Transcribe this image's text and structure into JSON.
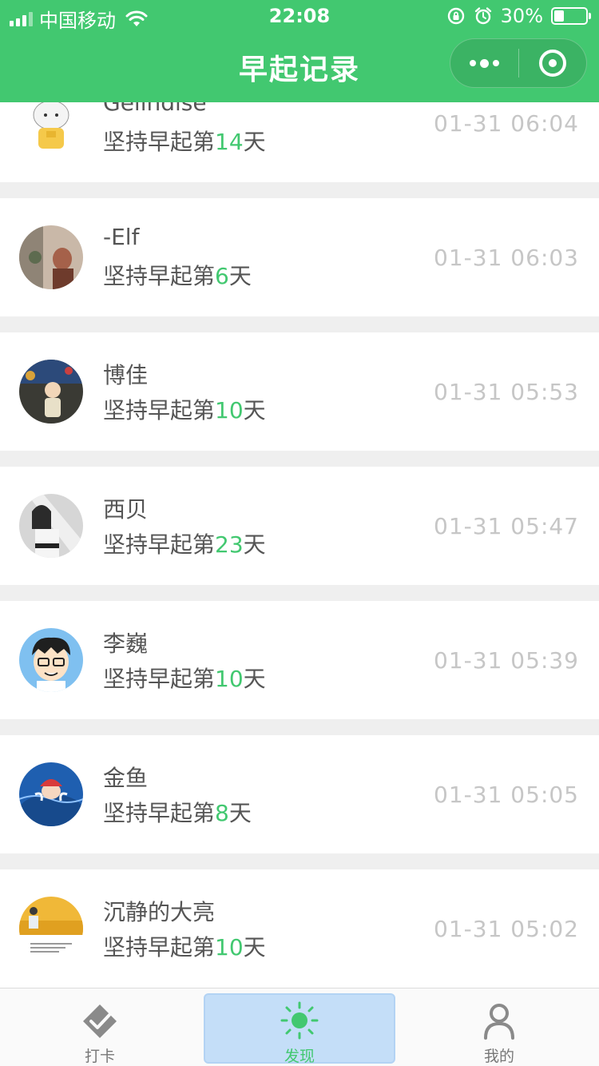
{
  "statusbar": {
    "carrier": "中国移动",
    "time": "22:08",
    "battery": "30%",
    "icons": [
      "signal-icon",
      "wifi-icon",
      "rotation-lock-icon",
      "alarm-icon",
      "battery-icon"
    ]
  },
  "navbar": {
    "title": "早起记录",
    "capsule_icons": [
      "more-icon",
      "close-miniprogram-icon"
    ]
  },
  "streak_text": {
    "prefix": "坚持早起第",
    "suffix": "天"
  },
  "records": [
    {
      "name": "Gelindise",
      "days": "14",
      "time": "01-31 06:04"
    },
    {
      "name": "-Elf",
      "days": "6",
      "time": "01-31 06:03"
    },
    {
      "name": "博佳",
      "days": "10",
      "time": "01-31 05:53"
    },
    {
      "name": "西贝",
      "days": "23",
      "time": "01-31 05:47"
    },
    {
      "name": "李巍",
      "days": "10",
      "time": "01-31 05:39"
    },
    {
      "name": "金鱼",
      "days": "8",
      "time": "01-31 05:05"
    },
    {
      "name": "沉静的大亮",
      "days": "10",
      "time": "01-31 05:02"
    }
  ],
  "tabbar": {
    "tabs": [
      {
        "label": "打卡",
        "icon": "checkin-icon",
        "active": false
      },
      {
        "label": "发现",
        "icon": "sun-icon",
        "active": true
      },
      {
        "label": "我的",
        "icon": "user-icon",
        "active": false
      }
    ]
  },
  "colors": {
    "primary": "#42c870",
    "muted_time": "#c6c6c6",
    "text": "#555555"
  }
}
